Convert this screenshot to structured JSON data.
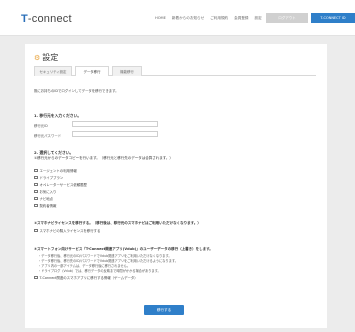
{
  "header": {
    "logo_prefix": "T",
    "logo_rest": "-connect",
    "nav": [
      "HOME",
      "新着からのお知らせ",
      "ご利用規約",
      "会員登録",
      "設定"
    ],
    "button_primary_grey": "ログアウト",
    "button_primary_blue": "T-CONNECT ID"
  },
  "page": {
    "title": "設定"
  },
  "tabs": [
    "セキュリティ設定",
    "データ移行",
    "機能移行"
  ],
  "intro": "既にお持ちのIDでログインしてデータを移行できます。",
  "step1": {
    "title": "1. 移行元を入力ください。",
    "fields": [
      {
        "label": "移行元ID"
      },
      {
        "label": "移行元パスワード"
      }
    ]
  },
  "step2": {
    "title": "2. 選択してください。",
    "desc": "①移行元からのデータコピーを行います。（移行元と移行先のデータは合算されます。）",
    "options": [
      "エージェントの利用情報",
      "ドライブプラン",
      "オペレーターサービス依頼履歴",
      "お気に入り",
      "ナビ地点",
      "契約者情報"
    ]
  },
  "step3": {
    "title": "②スマホナビライセンスを移行する。（移行後は、移行元のスマホナビはご利用いただけなくなります。）",
    "option": "スマホナビの購入ライセンスを移行する"
  },
  "step4": {
    "title": "③スマートフォン向けサービス「T-Connect関連アプリ(Vdub)」のユーザーデータの移行（上書き）をします。",
    "bullets": [
      "・データ移行後、移行元のID/パスワードでVdub関連アプリをご利用いただけなくなります。",
      "・データ移行後、移行先のID/パスワードでVdub関連アプリをご利用いただけるようになります。",
      "・アプリ内の一部アイテムは、データ移行後に移行されません。",
      "・ドライブログ（Vdub）では、移行データの反映まで時間がかかる場合があります。"
    ],
    "option": "T-Connect関連のスマホアプリに移行する情報（ゲームデータ）"
  },
  "submit_label": "移行する"
}
